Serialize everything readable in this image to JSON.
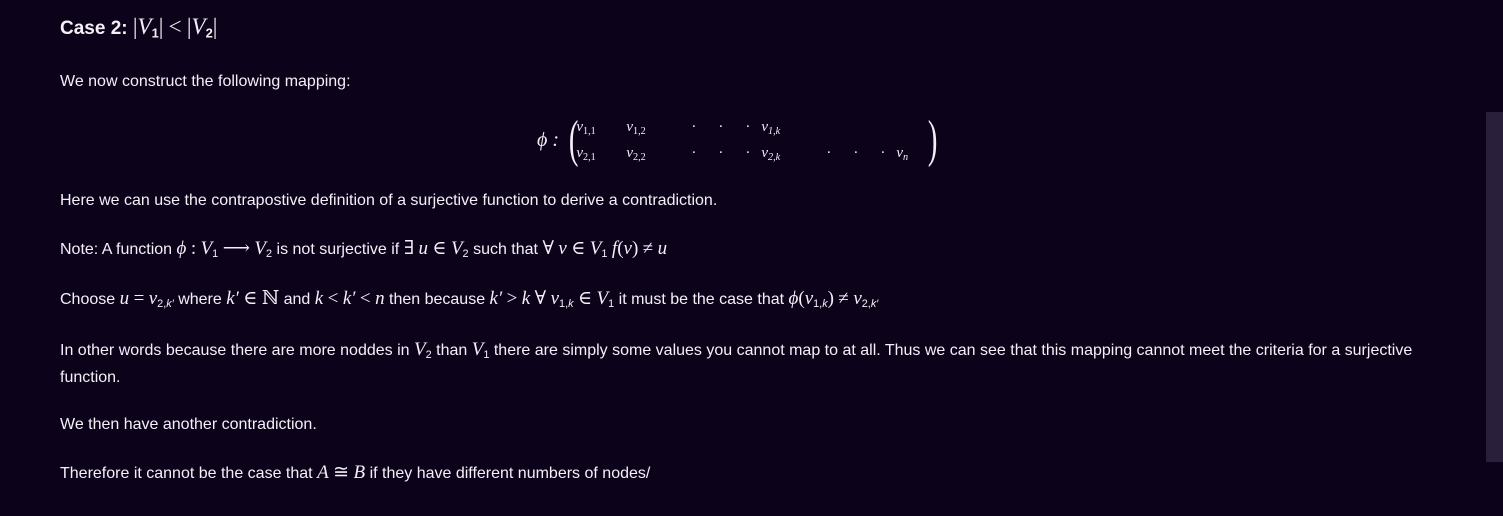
{
  "heading": {
    "prefix": "Case 2:",
    "math": "|V₁| < |V₂|"
  },
  "paragraphs": {
    "intro": "We now construct the following mapping:",
    "contrapositive": "Here we can use the contrapostive definition of a surjective function to derive a contradiction.",
    "note_text_1": "Note: A function",
    "note_text_2": "is not surjective if",
    "note_text_3": "such that",
    "choose_text_1": "Choose",
    "choose_text_2": "where",
    "choose_text_3": "and",
    "choose_text_4": "then because",
    "choose_text_5": "it must be the case that",
    "other_words_1": "In other words because there are more noddes in",
    "other_words_2": "than",
    "other_words_3": "there are simply some values you cannot map to at all. Thus we can see that this mapping cannot meet the criteria for a surjective function.",
    "another": "We then have another contradiction.",
    "therefore_1": "Therefore it cannot be the case that",
    "therefore_2": "if they have different numbers of nodes/"
  },
  "matrix": {
    "phi": "ϕ :",
    "row1": [
      "v1,1",
      "v1,2",
      "·",
      "·",
      "·",
      "v1,k"
    ],
    "row2": [
      "v2,1",
      "v2,2",
      "·",
      "·",
      "·",
      "v2,k",
      "·",
      "·",
      "·",
      "vn"
    ]
  }
}
